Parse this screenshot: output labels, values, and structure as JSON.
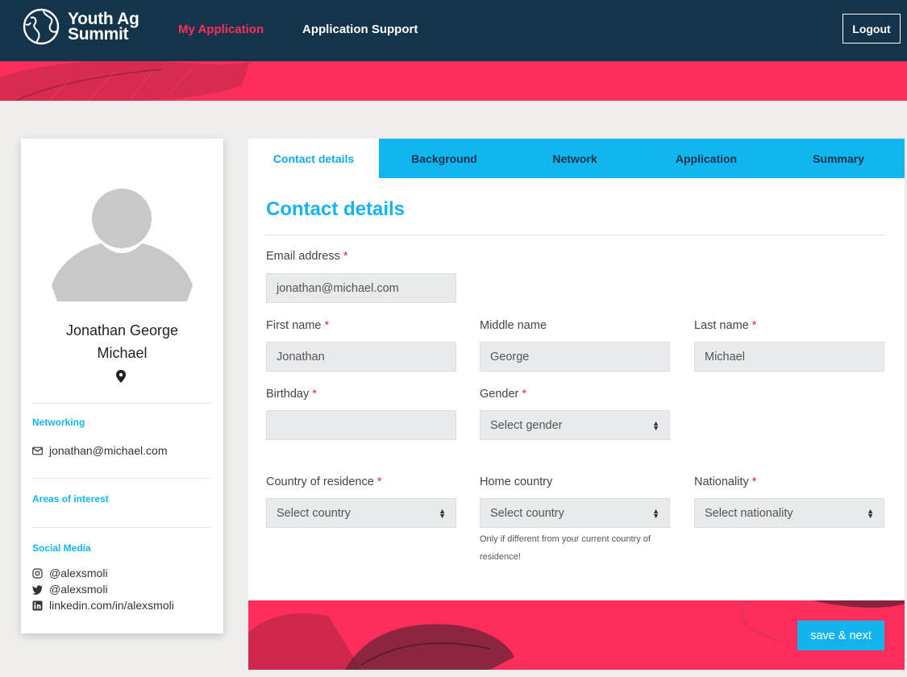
{
  "brand": {
    "line1": "Youth Ag",
    "line2": "Summit"
  },
  "nav": {
    "my_application": "My Application",
    "support": "Application Support",
    "logout": "Logout"
  },
  "profile": {
    "first_line": "Jonathan George",
    "second_line": "Michael",
    "networking_label": "Networking",
    "email": "jonathan@michael.com",
    "interests_label": "Areas of interest",
    "social_label": "Social Media",
    "instagram": "@alexsmoli",
    "twitter": "@alexsmoli",
    "linkedin": "linkedin.com/in/alexsmoli"
  },
  "tabs": [
    "Contact details",
    "Background",
    "Network",
    "Application",
    "Summary"
  ],
  "form": {
    "heading": "Contact details",
    "required_mark": "*",
    "email": {
      "label": "Email address",
      "value": "jonathan@michael.com"
    },
    "first_name": {
      "label": "First name",
      "value": "Jonathan"
    },
    "middle_name": {
      "label": "Middle name",
      "value": "George"
    },
    "last_name": {
      "label": "Last name",
      "value": "Michael"
    },
    "birthday": {
      "label": "Birthday",
      "value": ""
    },
    "gender": {
      "label": "Gender",
      "value": "Select gender"
    },
    "country_residence": {
      "label": "Country of residence",
      "value": "Select country"
    },
    "home_country": {
      "label": "Home country",
      "value": "Select country",
      "hint": "Only if different from your current country of residence!"
    },
    "nationality": {
      "label": "Nationality",
      "value": "Select nationality"
    }
  },
  "actions": {
    "save_next": "save & next"
  },
  "colors": {
    "navy": "#14344b",
    "pink": "#ff2d5a",
    "blue": "#11b6f0"
  }
}
